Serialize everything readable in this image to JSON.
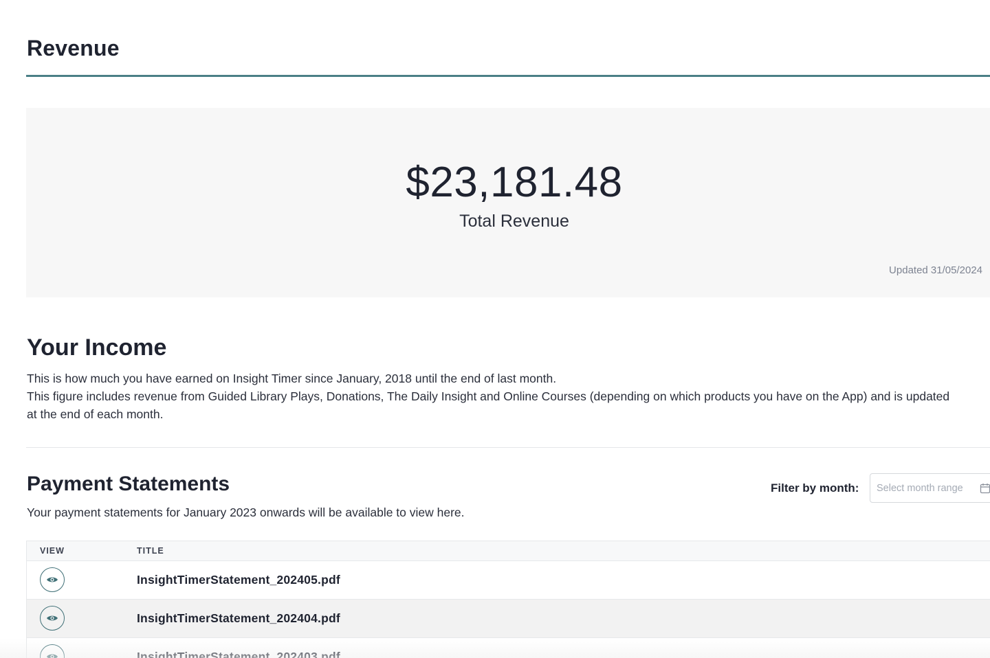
{
  "page": {
    "title": "Revenue"
  },
  "revenue": {
    "amount": "$23,181.48",
    "label": "Total Revenue",
    "updated": "Updated 31/05/2024"
  },
  "income": {
    "title": "Your Income",
    "line1": "This is how much you have earned on Insight Timer since January, 2018 until the end of last month.",
    "line2": "This figure includes revenue from Guided Library Plays, Donations, The Daily Insight and Online Courses (depending on which products you have on the App) and is updated",
    "line3": "at the end of each month."
  },
  "statements": {
    "title": "Payment Statements",
    "subtitle": "Your payment statements for January 2023 onwards will be available to view here.",
    "filter_label": "Filter by month:",
    "filter_placeholder": "Select month range",
    "columns": {
      "view": "VIEW",
      "title": "TITLE"
    },
    "rows": [
      {
        "file": "InsightTimerStatement_202405.pdf",
        "icon": "eye-icon"
      },
      {
        "file": "InsightTimerStatement_202404.pdf",
        "icon": "eye-icon"
      },
      {
        "file": "InsightTimerStatement_202403.pdf",
        "icon": "eye-icon"
      }
    ]
  },
  "colors": {
    "accent": "#4a7f86",
    "icon": "#3f6f76",
    "card_bg": "#f7f7f7",
    "alt_row_bg": "#f2f2f2",
    "text": "#1f2330",
    "muted": "#7d8391"
  }
}
